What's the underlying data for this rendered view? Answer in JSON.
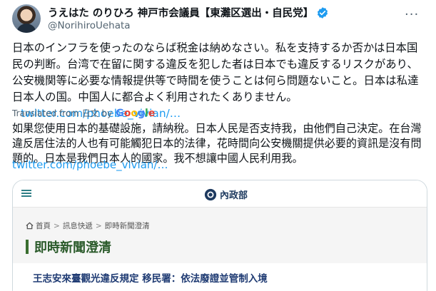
{
  "author": {
    "display_name": "うえはた のりひろ 神戸市会議員【東灘区選出・自民党】",
    "handle": "@NorihiroUehata"
  },
  "tweet": {
    "text": "日本のインフラを使ったのならば税金は納めなさい。私を支持するか否かは日本国民の判断。台湾で在留に関する違反を犯した者は日本でも違反するリスクがあり、公安機関等に必要な情報提供等で時間を使うことは何ら問題ないこと。日本は私達日本人の国。中国人に都合よく利用されたくありません。",
    "link": "twitter.com/phoebe_vivian/…"
  },
  "translation": {
    "label": "Translated from 日文 by",
    "provider": "Google",
    "text": "如果您使用日本的基礎設施，請納稅。日本人民是否支持我，由他們自己決定。在台灣違反居住法的人也有可能觸犯日本的法律，花時間向公安機關提供必要的資訊是沒有問題的。日本是我們日本人的國家。我不想讓中國人民利用我。",
    "link": "twitter.com/phoebe_vivian/…"
  },
  "card": {
    "ministry_name": "內政部",
    "breadcrumb": [
      "首頁",
      "訊息快遞",
      "即時新聞澄清"
    ],
    "section_title": "即時新聞澄清",
    "news_title": "王志安來臺觀光違反規定 移民署：依法廢證並管制入境"
  },
  "icons": {
    "verified": "verified-badge-icon",
    "more": "more-options-icon",
    "menu": "hamburger-menu-icon",
    "home": "home-icon",
    "emblem": "ministry-emblem-icon"
  },
  "colors": {
    "link": "#1d9bf0",
    "verified": "#1d9bf0",
    "muted": "#536471",
    "section_green": "#2a5a2a",
    "news_blue": "#1f3b73"
  }
}
